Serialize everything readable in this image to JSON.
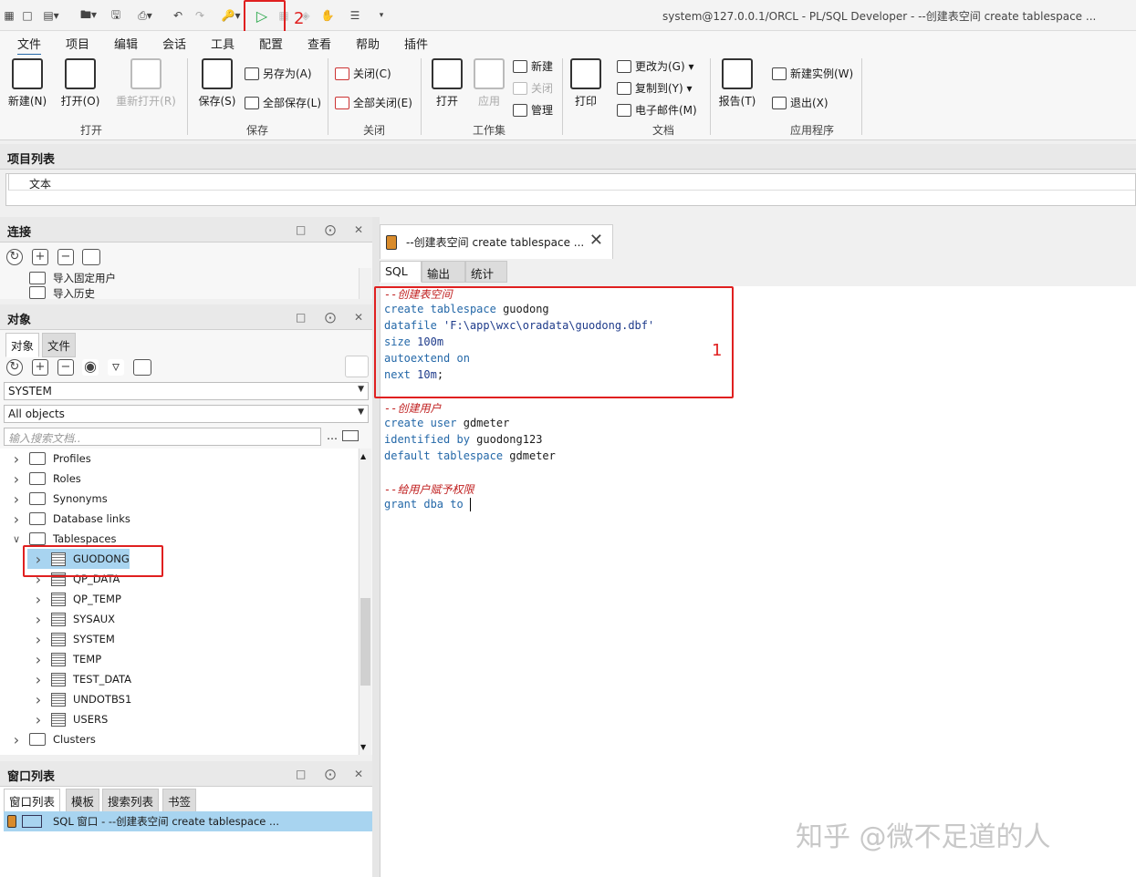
{
  "window": {
    "title": "system@127.0.0.1/ORCL - PL/SQL Developer - --创建表空间 create tablespace  ..."
  },
  "menu": [
    "文件",
    "项目",
    "编辑",
    "会话",
    "工具",
    "配置",
    "查看",
    "帮助",
    "插件"
  ],
  "ribbon": {
    "open_group": {
      "new": "新建(N)",
      "open": "打开(O)",
      "reopen": "重新打开(R)",
      "label": "打开"
    },
    "save_group": {
      "save": "保存(S)",
      "save_as": "另存为(A)",
      "save_all": "全部保存(L)",
      "label": "保存"
    },
    "close_group": {
      "close": "关闭(C)",
      "close_all": "全部关闭(E)",
      "label": "关闭"
    },
    "workset_group": {
      "open": "打开",
      "apply": "应用",
      "new": "新建",
      "close": "关闭",
      "manage": "管理",
      "label": "工作集"
    },
    "doc_group": {
      "print": "打印",
      "change_to": "更改为(G)",
      "copy_to": "复制到(Y)",
      "email": "电子邮件(M)",
      "label": "文档"
    },
    "app_group": {
      "report": "报告(T)",
      "new_instance": "新建实例(W)",
      "exit": "退出(X)",
      "label": "应用程序"
    }
  },
  "project_panel": {
    "title": "项目列表",
    "column": "文本"
  },
  "connection_panel": {
    "title": "连接",
    "items": [
      "导入固定用户",
      "导入历史"
    ]
  },
  "objects_panel": {
    "title": "对象",
    "tabs": [
      "对象",
      "文件"
    ],
    "schema": "SYSTEM",
    "filter": "All objects",
    "search_placeholder": "输入搜索文档..",
    "tree": {
      "folders_top": [
        "Profiles",
        "Roles",
        "Synonyms",
        "Database links",
        "Tablespaces"
      ],
      "tablespaces": [
        "GUODONG",
        "QP_DATA",
        "QP_TEMP",
        "SYSAUX",
        "SYSTEM",
        "TEMP",
        "TEST_DATA",
        "UNDOTBS1",
        "USERS"
      ],
      "folders_bottom": [
        "Clusters"
      ]
    }
  },
  "window_list_panel": {
    "title": "窗口列表",
    "tabs": [
      "窗口列表",
      "模板",
      "搜索列表",
      "书签"
    ],
    "item": "SQL 窗口 - --创建表空间 create tablespace  ..."
  },
  "editor": {
    "doc_tab": "--创建表空间 create tablespace  ...",
    "tabs": [
      "SQL",
      "输出",
      "统计"
    ],
    "lines": [
      {
        "text": "--创建表空间",
        "kind": "comment"
      },
      {
        "text": "create tablespace guodong",
        "kind": "code"
      },
      {
        "text": "datafile 'F:\\app\\wxc\\oradata\\guodong.dbf'",
        "kind": "code"
      },
      {
        "text": "size 100m",
        "kind": "code"
      },
      {
        "text": "autoextend on",
        "kind": "code"
      },
      {
        "text": "next 10m;",
        "kind": "code"
      },
      {
        "text": "",
        "kind": "blank"
      },
      {
        "text": "--创建用户",
        "kind": "comment"
      },
      {
        "text": "create user gdmeter",
        "kind": "code"
      },
      {
        "text": "identified by guodong123",
        "kind": "code"
      },
      {
        "text": "default tablespace gdmeter",
        "kind": "code"
      },
      {
        "text": "",
        "kind": "blank"
      },
      {
        "text": "--给用户赋予权限",
        "kind": "comment"
      },
      {
        "text": "grant dba to ",
        "kind": "code"
      }
    ]
  },
  "annotations": {
    "label1": "1",
    "label2": "2"
  },
  "watermark": "知乎 @微不足道的人",
  "colors": {
    "highlight": "#a8d4f0",
    "annotation": "#e02020",
    "run": "#2aa84a"
  }
}
